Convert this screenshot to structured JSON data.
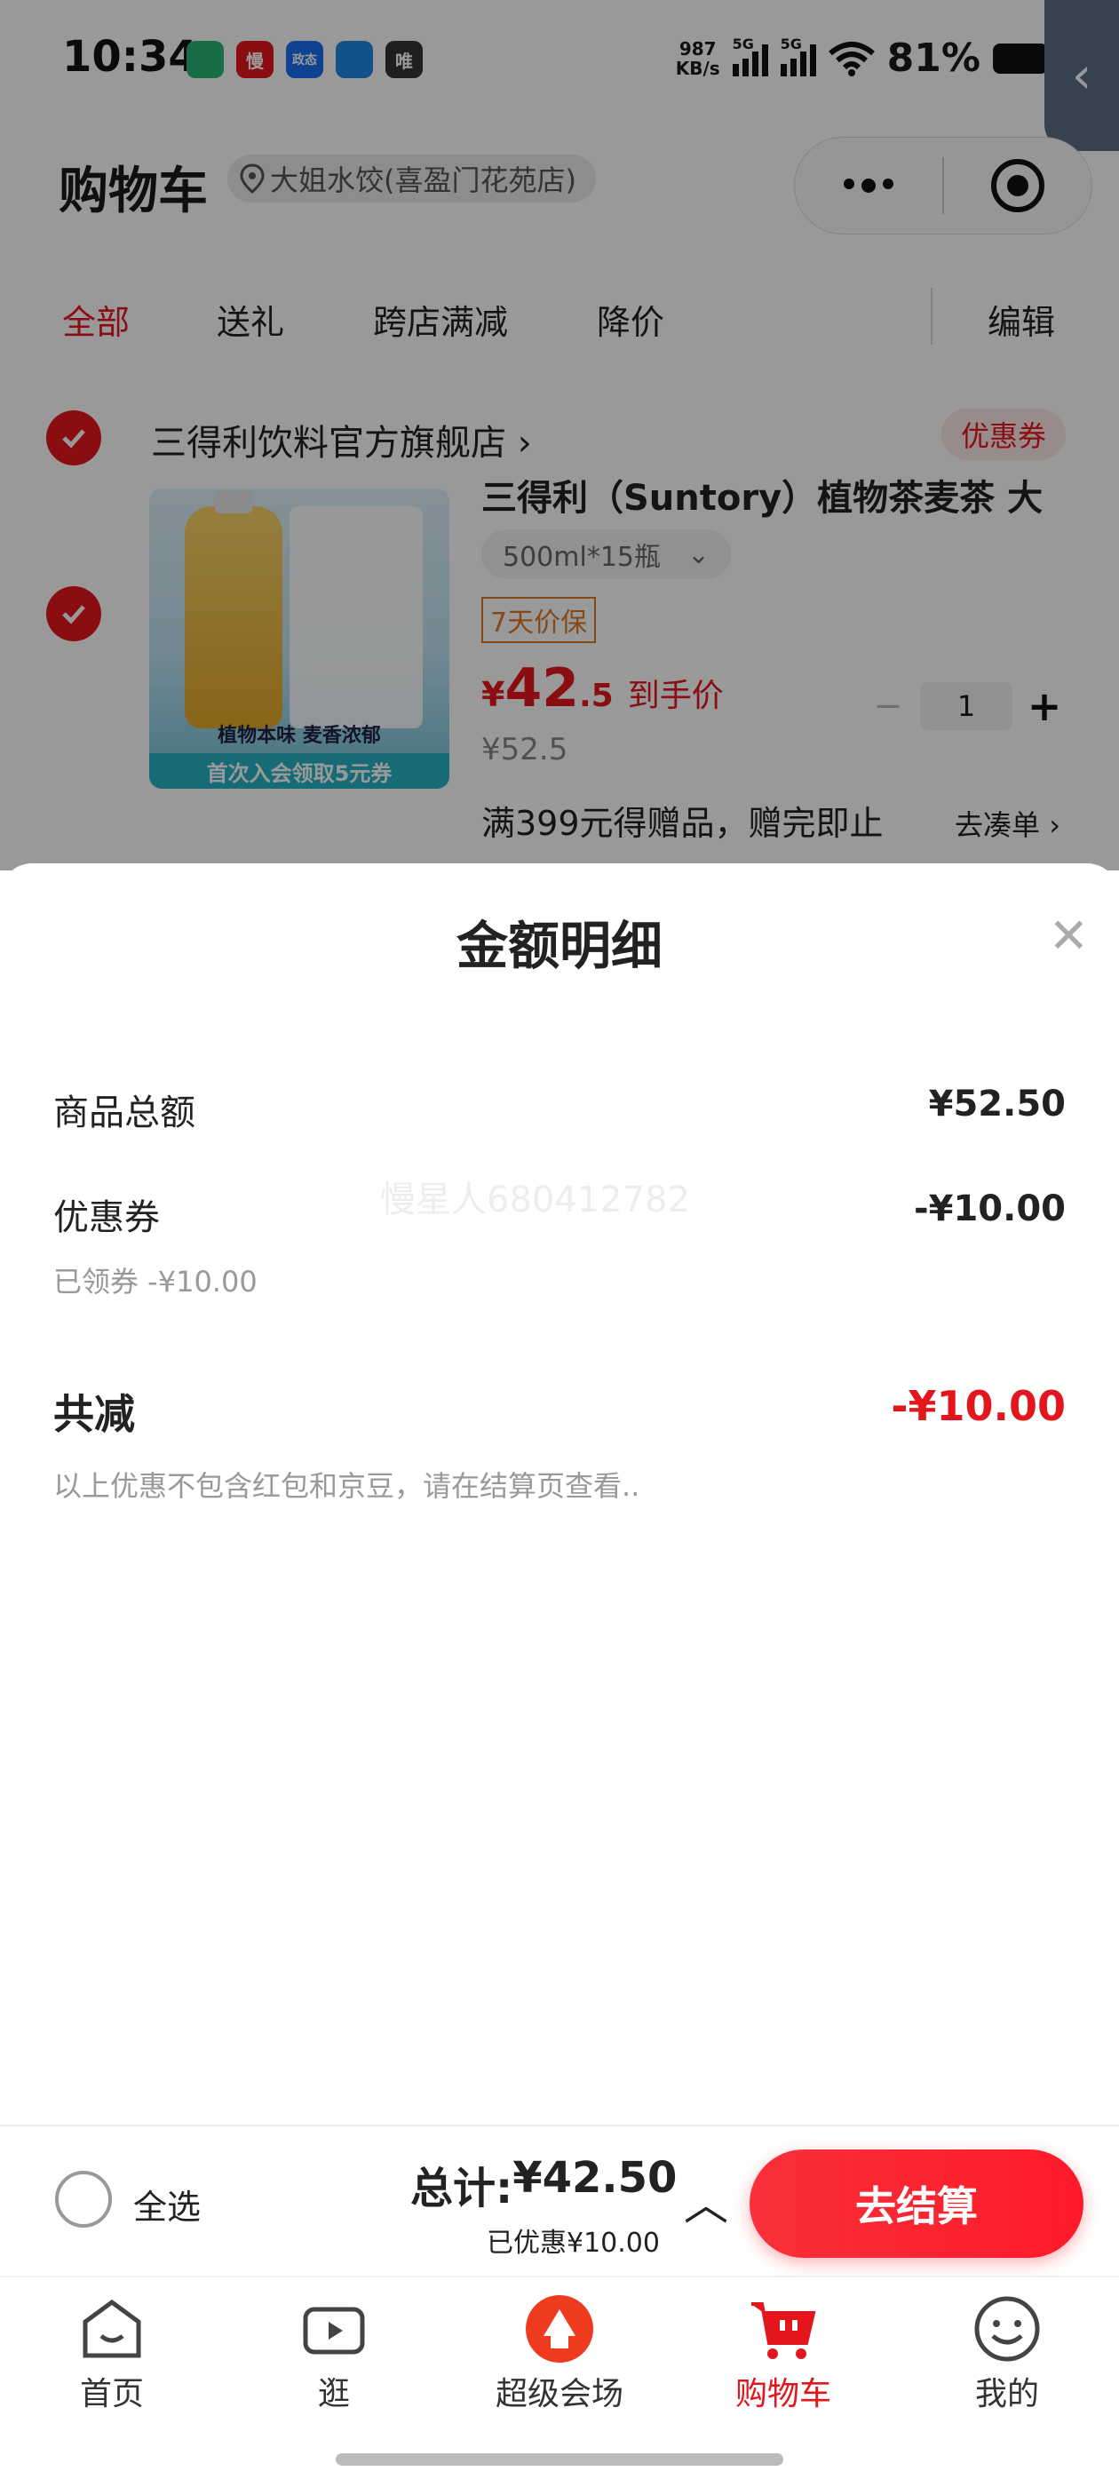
{
  "status_bar": {
    "time": "10:34",
    "app_icons": [
      {
        "name": "app-icon-1",
        "glyph": "",
        "color": "#2bb673"
      },
      {
        "name": "app-icon-2",
        "glyph": "慢",
        "color": "#e4161d"
      },
      {
        "name": "app-icon-3",
        "glyph": "政态",
        "color": "#1a6ff0"
      },
      {
        "name": "app-icon-4",
        "glyph": "",
        "color": "#1e88e5"
      },
      {
        "name": "app-icon-5",
        "glyph": "唯",
        "color": "#333333"
      }
    ],
    "net_speed_value": "987",
    "net_speed_unit": "KB/s",
    "signal_1": "5G",
    "signal_2": "5G",
    "battery": "81%"
  },
  "header": {
    "title": "购物车",
    "location": "大姐水饺(喜盈门花苑店)"
  },
  "tabs": [
    {
      "label": "全部",
      "active": true
    },
    {
      "label": "送礼",
      "active": false
    },
    {
      "label": "跨店满减",
      "active": false
    },
    {
      "label": "降价",
      "active": false
    },
    {
      "label": "编辑",
      "active": false
    }
  ],
  "store": {
    "name": "三得利饮料官方旗舰店",
    "coupon_label": "优惠券",
    "product": {
      "title": "三得利（Suntory）植物茶麦茶 大",
      "spec": "500ml*15瓶",
      "guarantee": "7天价保",
      "price_currency": "¥",
      "price_int": "42",
      "price_dec": ".5",
      "price_tag": "到手价",
      "original_price": "¥52.5",
      "quantity": "1",
      "promo_text": "满399元得赠品，赠完即止",
      "promo_link": "去凑单",
      "image_caption": "植物本味 麦香浓郁",
      "image_banner": "首次入会领取5元券"
    }
  },
  "sheet": {
    "title": "金额明细",
    "watermark": "慢星人680412782",
    "rows": {
      "subtotal_label": "商品总额",
      "subtotal_value": "¥52.50",
      "coupon_label": "优惠券",
      "coupon_value": "-¥10.00",
      "coupon_sub": "已领券 -¥10.00",
      "total_reduce_label": "共减",
      "total_reduce_value": "-¥10.00",
      "note": "以上优惠不包含红包和京豆，请在结算页查看.."
    }
  },
  "checkout": {
    "select_all": "全选",
    "total_prefix": "总计:",
    "total_value": "¥42.50",
    "saved": "已优惠¥10.00",
    "button": "去结算"
  },
  "tabbar": [
    {
      "label": "首页",
      "active": false
    },
    {
      "label": "逛",
      "active": false
    },
    {
      "label": "超级会场",
      "active": false
    },
    {
      "label": "购物车",
      "active": true
    },
    {
      "label": "我的",
      "active": false
    }
  ],
  "colors": {
    "accent": "#e4161d",
    "guarantee": "#e07b26"
  }
}
